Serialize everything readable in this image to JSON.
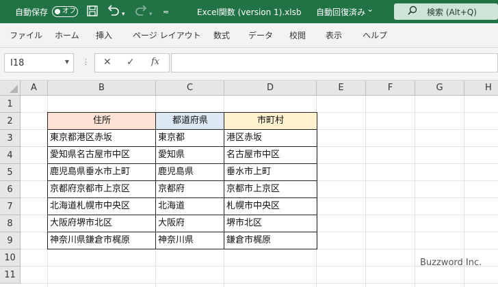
{
  "titlebar": {
    "autosave_label": "自動保存",
    "autosave_state": "オフ",
    "save_icon": "save-icon",
    "undo_icon": "undo-icon",
    "redo_icon": "redo-icon",
    "customize_icon": "customize-qat-icon",
    "doc_title": "Excel関数 (version 1).xlsb",
    "save_status": "自動回復済み",
    "save_status_chevron": "⌄",
    "search_label": "検索 (Alt+Q)",
    "search_icon": "search-icon",
    "bg_color": "#217346"
  },
  "ribbon": {
    "tabs": [
      "ファイル",
      "ホーム",
      "挿入",
      "ページ レイアウト",
      "数式",
      "データ",
      "校閲",
      "表示",
      "ヘルプ"
    ]
  },
  "formula_bar": {
    "name_box_value": "I18",
    "cancel_icon": "✕",
    "enter_icon": "✓",
    "fx_label": "fx",
    "formula_value": ""
  },
  "sheet": {
    "columns": [
      "A",
      "B",
      "C",
      "D",
      "E",
      "F",
      "G",
      "H"
    ],
    "rows": [
      "1",
      "2",
      "3",
      "4",
      "5",
      "6",
      "7",
      "8",
      "9",
      "10",
      "11"
    ],
    "table": {
      "headers": [
        "住所",
        "都道府県",
        "市町村"
      ],
      "header_colors": [
        "#fbe2d5",
        "#dce9f5",
        "#fff2cc"
      ],
      "rows": [
        [
          "東京都港区赤坂",
          "東京都",
          "港区赤坂"
        ],
        [
          "愛知県名古屋市中区",
          "愛知県",
          "名古屋市中区"
        ],
        [
          "鹿児島県垂水市上町",
          "鹿児島県",
          "垂水市上町"
        ],
        [
          "京都府京都市上京区",
          "京都府",
          "京都市上京区"
        ],
        [
          "北海道札幌市中央区",
          "北海道",
          "札幌市中央区"
        ],
        [
          "大阪府堺市北区",
          "大阪府",
          "堺市北区"
        ],
        [
          "神奈川県鎌倉市梶原",
          "神奈川県",
          "鎌倉市梶原"
        ]
      ]
    }
  },
  "watermark": "Buzzword Inc."
}
